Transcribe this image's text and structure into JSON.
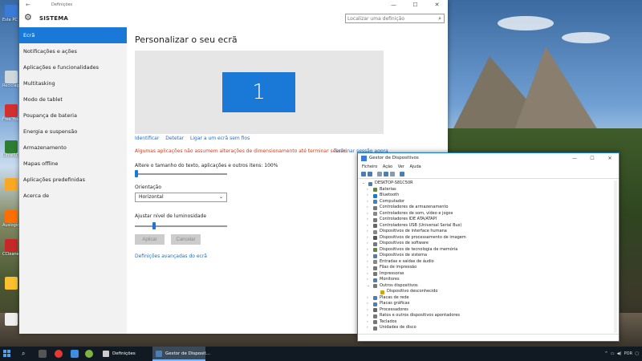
{
  "settings_window": {
    "title": "Definições",
    "section": "SISTEMA",
    "search_placeholder": "Localizar uma definição",
    "nav": [
      {
        "label": "Ecrã",
        "active": true
      },
      {
        "label": "Notificações e ações"
      },
      {
        "label": "Aplicações e funcionalidades"
      },
      {
        "label": "Multitasking"
      },
      {
        "label": "Modo de tablet"
      },
      {
        "label": "Poupança de bateria"
      },
      {
        "label": "Energia e suspensão"
      },
      {
        "label": "Armazenamento"
      },
      {
        "label": "Mapas offline"
      },
      {
        "label": "Aplicações predefinidas"
      },
      {
        "label": "Acerca de"
      }
    ],
    "page_title": "Personalizar o seu ecrã",
    "monitor_number": "1",
    "links": {
      "identify": "Identificar",
      "detect": "Detetar",
      "wireless": "Ligar a um ecrã sem fios"
    },
    "warning": "Algumas aplicações não assumem alterações de dimensionamento até terminar sessão.",
    "warning_link": "Terminar sessão agora",
    "scale_label": "Altere o tamanho do texto, aplicações e outros itens: 100%",
    "scale_value": 0.0,
    "orientation_label": "Orientação",
    "orientation_value": "Horizontal",
    "brightness_label": "Ajustar nível de luminosidade",
    "brightness_value": 0.2,
    "apply": "Aplicar",
    "cancel": "Cancelar",
    "advanced_link": "Definições avançadas do ecrã"
  },
  "device_manager": {
    "title": "Gestor de Dispositivos",
    "menu": [
      "Ficheiro",
      "Ação",
      "Ver",
      "Ajuda"
    ],
    "root": "DESKTOP-S81C50R",
    "nodes": [
      {
        "label": "Baterias",
        "icon": "battery-icon",
        "color": "#5a8a3a"
      },
      {
        "label": "Bluetooth",
        "icon": "bluetooth-icon",
        "color": "#1a78d7"
      },
      {
        "label": "Computador",
        "icon": "computer-icon",
        "color": "#4a7fb5"
      },
      {
        "label": "Controladores de armazenamento",
        "icon": "storage-icon",
        "color": "#777"
      },
      {
        "label": "Controladores de som, vídeo e jogos",
        "icon": "sound-icon",
        "color": "#888"
      },
      {
        "label": "Controladores IDE ATA/ATAPI",
        "icon": "ide-icon",
        "color": "#777"
      },
      {
        "label": "Controladores USB (Universal Serial Bus)",
        "icon": "usb-icon",
        "color": "#666"
      },
      {
        "label": "Dispositivos de interface humana",
        "icon": "hid-icon",
        "color": "#888"
      },
      {
        "label": "Dispositivos de processamento de imagem",
        "icon": "camera-icon",
        "color": "#555"
      },
      {
        "label": "Dispositivos de software",
        "icon": "software-icon",
        "color": "#777"
      },
      {
        "label": "Dispositivos de tecnologia de memória",
        "icon": "memory-icon",
        "color": "#5a8a3a"
      },
      {
        "label": "Dispositivos de sistema",
        "icon": "system-icon",
        "color": "#4a7fb5"
      },
      {
        "label": "Entradas e saídas de áudio",
        "icon": "audio-icon",
        "color": "#888"
      },
      {
        "label": "Filas de impressão",
        "icon": "print-queue-icon",
        "color": "#777"
      },
      {
        "label": "Impressoras",
        "icon": "printer-icon",
        "color": "#777"
      },
      {
        "label": "Monitores",
        "icon": "monitor-icon",
        "color": "#4a7fb5"
      },
      {
        "label": "Outros dispositivos",
        "icon": "unknown-device-icon",
        "color": "#777",
        "expanded": true
      },
      {
        "label": "Dispositivo desconhecido",
        "icon": "warning-icon",
        "color": "#d4a017",
        "child": true
      },
      {
        "label": "Placas de rede",
        "icon": "network-icon",
        "color": "#4a7fb5"
      },
      {
        "label": "Placas gráficas",
        "icon": "graphics-icon",
        "color": "#4a7fb5"
      },
      {
        "label": "Processadores",
        "icon": "cpu-icon",
        "color": "#666"
      },
      {
        "label": "Ratos e outros dispositivos apontadores",
        "icon": "mouse-icon",
        "color": "#777"
      },
      {
        "label": "Teclados",
        "icon": "keyboard-icon",
        "color": "#777"
      },
      {
        "label": "Unidades de disco",
        "icon": "disk-icon",
        "color": "#777"
      }
    ]
  },
  "desktop_icons": [
    {
      "label": "Este PC",
      "color": "#3a7bd5"
    },
    {
      "label": "Reciclagem",
      "color": "#cfd8dc"
    },
    {
      "label": "Free YouTube Downl...",
      "color": "#d32f2f"
    },
    {
      "label": "UltraISO",
      "color": "#2e7d32"
    },
    {
      "label": "",
      "color": "#f9a825"
    },
    {
      "label": "Auslogics DiskDef...",
      "color": "#ff6f00"
    },
    {
      "label": "CCleaner",
      "color": "#c62828"
    },
    {
      "label": "",
      "color": "#fbc02d"
    },
    {
      "label": "",
      "color": "#eeeeee"
    }
  ],
  "taskbar": {
    "tasks": [
      {
        "label": "Definições",
        "active": false
      },
      {
        "label": "Gestor de Disposit...",
        "active": true
      }
    ],
    "tray_text": "POR"
  }
}
